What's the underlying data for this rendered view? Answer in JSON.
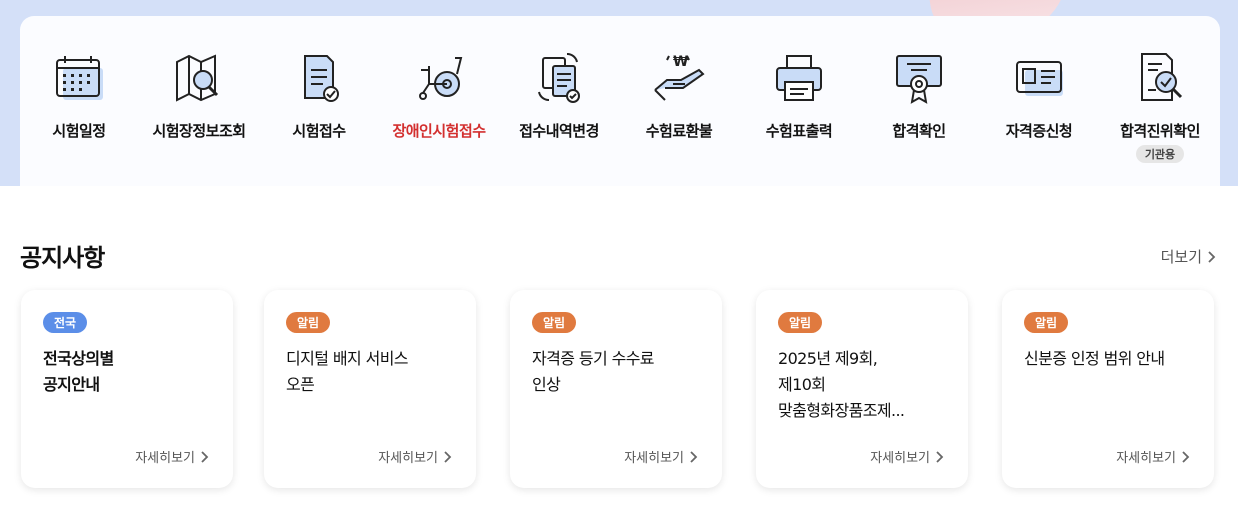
{
  "menu": {
    "items": [
      {
        "label": "시험일정",
        "icon": "calendar-icon"
      },
      {
        "label": "시험장정보조회",
        "icon": "map-search-icon"
      },
      {
        "label": "시험접수",
        "icon": "document-check-icon"
      },
      {
        "label": "장애인시험접수",
        "icon": "wheelchair-icon"
      },
      {
        "label": "접수내역변경",
        "icon": "document-refresh-icon"
      },
      {
        "label": "수험료환불",
        "icon": "refund-hand-icon"
      },
      {
        "label": "수험표출력",
        "icon": "printer-icon"
      },
      {
        "label": "합격확인",
        "icon": "certificate-award-icon"
      },
      {
        "label": "자격증신청",
        "icon": "id-card-icon"
      },
      {
        "label": "합격진위확인",
        "icon": "document-verify-icon",
        "badge": "기관용"
      }
    ],
    "active_index": 3,
    "active_color": "#d32f2f"
  },
  "notice": {
    "title": "공지사항",
    "more_label": "더보기",
    "detail_label": "자세히보기",
    "cards": [
      {
        "tag": "전국",
        "line1": "전국상의별",
        "line2": "공지안내",
        "line3": ""
      },
      {
        "tag": "알림",
        "line1": "디지털 배지 서비스",
        "line2": "오픈",
        "line3": ""
      },
      {
        "tag": "알림",
        "line1": "자격증 등기 수수료",
        "line2": "인상",
        "line3": ""
      },
      {
        "tag": "알림",
        "line1": "2025년 제9회,",
        "line2": "제10회",
        "line3": "맞춤형화장품조제..."
      },
      {
        "tag": "알림",
        "line1": "신분증 인정 범위 안내",
        "line2": "",
        "line3": ""
      }
    ]
  },
  "colors": {
    "tag_blue": "#5b8ee8",
    "tag_orange": "#e07a3f",
    "band": "#d4e0f8"
  }
}
